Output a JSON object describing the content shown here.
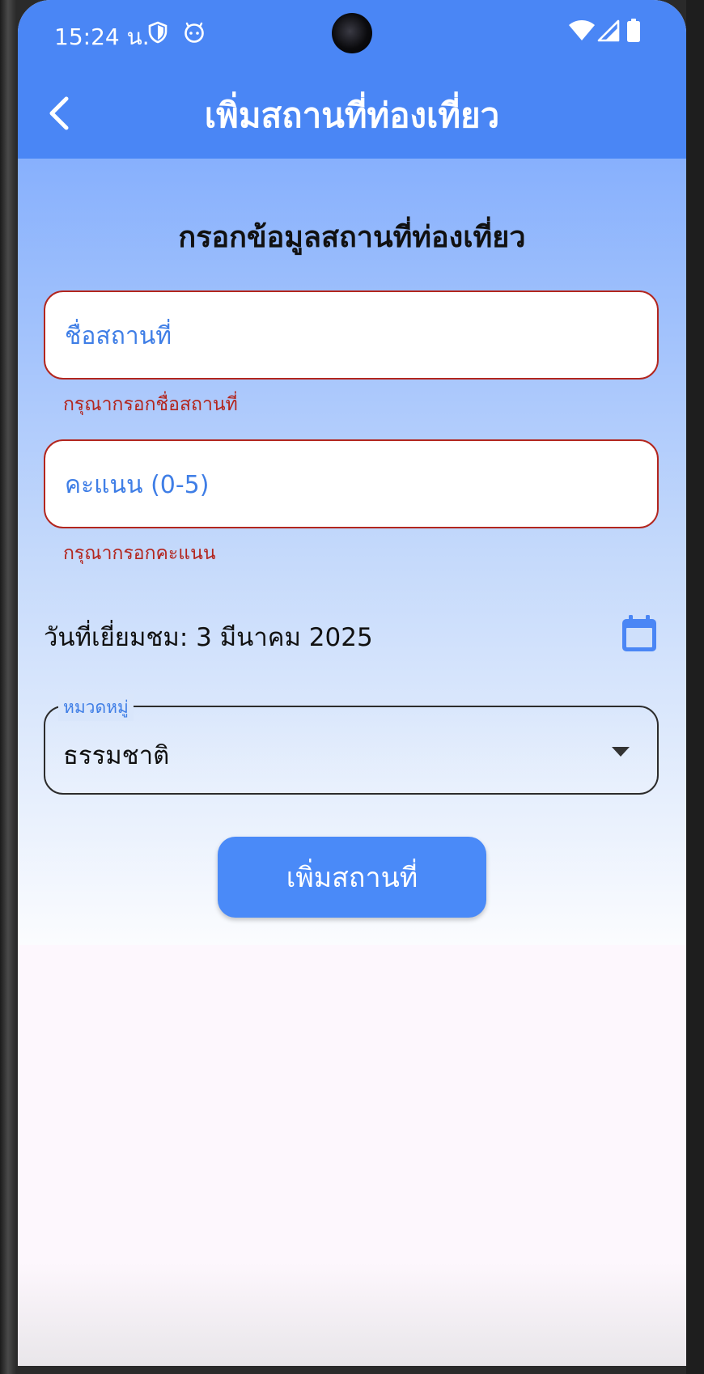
{
  "status_bar": {
    "time": "15:24 น.",
    "icons": [
      "shield-icon",
      "face-icon",
      "wifi-icon",
      "signal-icon",
      "battery-icon"
    ]
  },
  "app_bar": {
    "title": "เพิ่มสถานที่ท่องเที่ยว",
    "back_icon": "chevron-left-icon"
  },
  "form": {
    "heading": "กรอกข้อมูลสถานที่ท่องเที่ยว",
    "name_field": {
      "placeholder": "ชื่อสถานที่",
      "value": "",
      "error": "กรุณากรอกชื่อสถานที่"
    },
    "score_field": {
      "placeholder": "คะแนน (0-5)",
      "value": "",
      "error": "กรุณากรอกคะแนน"
    },
    "visit_date": "วันที่เยี่ยมชม: 3 มีนาคม 2025",
    "category": {
      "label": "หมวดหมู่",
      "selected": "ธรรมชาติ"
    },
    "submit_label": "เพิ่มสถานที่"
  },
  "colors": {
    "primary": "#4a86f5",
    "error": "#b3261e",
    "placeholder": "#3f7ee6"
  }
}
